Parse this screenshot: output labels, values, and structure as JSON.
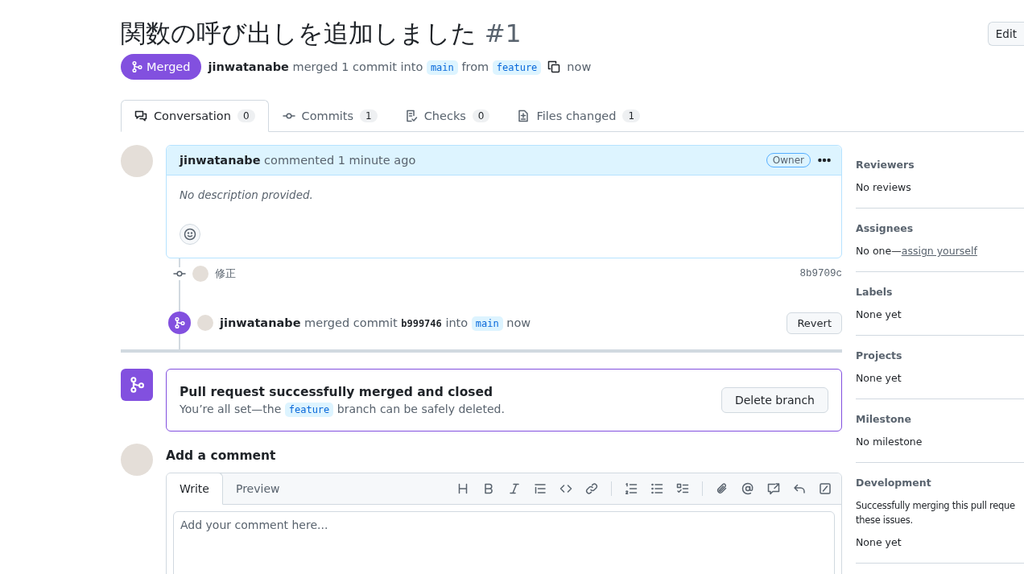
{
  "title": "関数の呼び出しを追加しました",
  "number": "#1",
  "edit_button": "Edit",
  "status": {
    "label": "Merged",
    "kind": "merged"
  },
  "summary": {
    "author": "jinwatanabe",
    "text_1": "merged 1 commit into",
    "base": "main",
    "text_2": "from",
    "head": "feature",
    "time": "now"
  },
  "tabs": [
    {
      "kind": "conversation",
      "label": "Conversation",
      "count": "0",
      "selected": true
    },
    {
      "kind": "commits",
      "label": "Commits",
      "count": "1",
      "selected": false
    },
    {
      "kind": "checks",
      "label": "Checks",
      "count": "0",
      "selected": false
    },
    {
      "kind": "files",
      "label": "Files changed",
      "count": "1",
      "selected": false
    }
  ],
  "comment": {
    "author": "jinwatanabe",
    "action": "commented 1 minute ago",
    "badge": "Owner",
    "body": "No description provided."
  },
  "commits": [
    {
      "message": "修正",
      "sha": "8b9709c"
    }
  ],
  "merge_event": {
    "author": "jinwatanabe",
    "action": "merged commit",
    "sha": "b999746",
    "text": "into",
    "branch": "main",
    "time": "now",
    "button": "Revert"
  },
  "merged_box": {
    "title": "Pull request successfully merged and closed",
    "text_1": "You’re all set—the",
    "branch": "feature",
    "text_2": "branch can be safely deleted.",
    "button": "Delete branch"
  },
  "composer": {
    "heading": "Add a comment",
    "tabs": [
      {
        "label": "Write",
        "selected": true
      },
      {
        "label": "Preview",
        "selected": false
      }
    ],
    "placeholder": "Add your comment here..."
  },
  "sidebar": [
    {
      "kind": "text",
      "heading": "Reviewers",
      "value": "No reviews"
    },
    {
      "kind": "assign",
      "heading": "Assignees",
      "value": "No one—",
      "link": "assign yourself"
    },
    {
      "kind": "text",
      "heading": "Labels",
      "value": "None yet"
    },
    {
      "kind": "text",
      "heading": "Projects",
      "value": "None yet"
    },
    {
      "kind": "text",
      "heading": "Milestone",
      "value": "No milestone"
    },
    {
      "kind": "development",
      "heading": "Development",
      "lines": [
        "Successfully merging this pull reque",
        "these issues."
      ],
      "value": "None yet"
    }
  ]
}
